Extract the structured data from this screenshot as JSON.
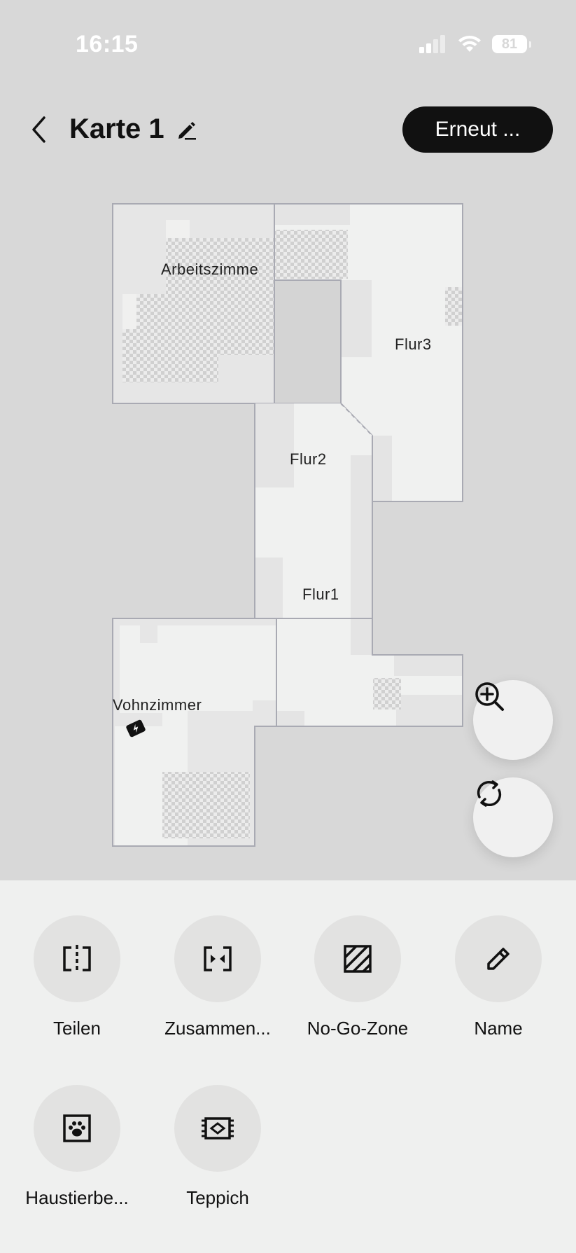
{
  "status_bar": {
    "time": "16:15",
    "battery": "81"
  },
  "header": {
    "title": "Karte 1",
    "retry_label": "Erneut ..."
  },
  "rooms": {
    "arbeitszimmer": "Arbeitszimme",
    "flur3": "Flur3",
    "flur2": "Flur2",
    "flur1": "Flur1",
    "wohnzimmer": "Vohnzimmer"
  },
  "tools": [
    {
      "label": "Teilen",
      "icon": "split-icon"
    },
    {
      "label": "Zusammen...",
      "icon": "merge-icon"
    },
    {
      "label": "No-Go-Zone",
      "icon": "no-go-zone-icon"
    },
    {
      "label": "Name",
      "icon": "pencil-icon"
    },
    {
      "label": "Haustierbe...",
      "icon": "pet-area-icon"
    },
    {
      "label": "Teppich",
      "icon": "carpet-icon"
    }
  ]
}
